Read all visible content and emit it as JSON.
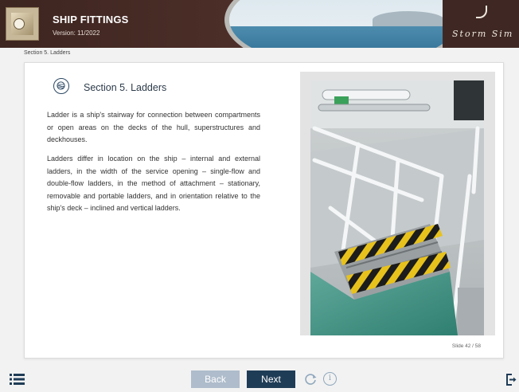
{
  "header": {
    "title": "SHIP FITTINGS",
    "version": "Version: 11/2022",
    "brand": "Storm Sim",
    "logo_icon": "ship-emblem-icon"
  },
  "breadcrumb": "Section 5. Ladders",
  "content": {
    "section_icon": "ship-porthole-icon",
    "section_title": "Section 5. Ladders",
    "paragraph1": "Ladder is a ship's stairway for connection between compartments or open areas on the decks of the hull, superstructures and deckhouses.",
    "paragraph2": "Ladders differ in location on the ship – internal and external ladders, in the width of the service opening – single-flow and double-flow ladders, in the method of attachment – stationary, removable and portable ladders, and in orientation relative to the ship's deck – inclined and vertical ladders.",
    "photo_subject": "ship ladder with yellow-black striped steps",
    "slide_counter": "Slide 42 / 58"
  },
  "footer": {
    "menu_icon": "list-menu-icon",
    "back_label": "Back",
    "next_label": "Next",
    "reload_icon": "reload-icon",
    "info_label": "i",
    "exit_icon": "exit-icon"
  },
  "colors": {
    "header_bg": "#4c2e28",
    "next_button": "#1f3c56",
    "back_button": "#aebccb",
    "accent_blue": "#2d4964"
  }
}
